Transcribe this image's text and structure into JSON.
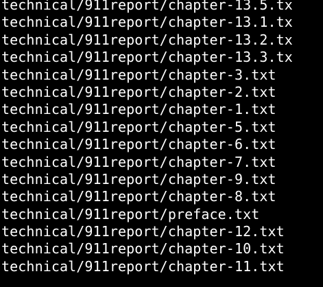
{
  "terminal": {
    "background": "#000000",
    "foreground": "#ffffff",
    "lines": [
      "technical/911report/chapter-13.5.tx",
      "technical/911report/chapter-13.1.tx",
      "technical/911report/chapter-13.2.tx",
      "technical/911report/chapter-13.3.tx",
      "technical/911report/chapter-3.txt",
      "technical/911report/chapter-2.txt",
      "technical/911report/chapter-1.txt",
      "technical/911report/chapter-5.txt",
      "technical/911report/chapter-6.txt",
      "technical/911report/chapter-7.txt",
      "technical/911report/chapter-9.txt",
      "technical/911report/chapter-8.txt",
      "technical/911report/preface.txt",
      "technical/911report/chapter-12.txt",
      "technical/911report/chapter-10.txt",
      "technical/911report/chapter-11.txt"
    ]
  }
}
